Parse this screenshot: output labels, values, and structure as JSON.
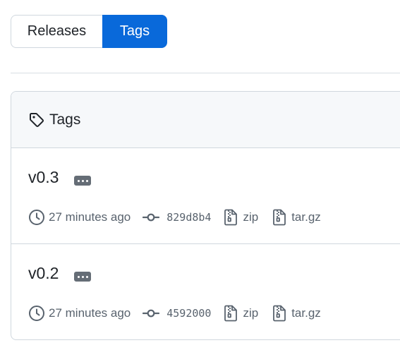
{
  "tabs": {
    "releases_label": "Releases",
    "tags_label": "Tags",
    "selected": "Tags"
  },
  "box": {
    "header_title": "Tags"
  },
  "tags": [
    {
      "name": "v0.3",
      "time": "27 minutes ago",
      "commit": "829d8b4",
      "zip_label": "zip",
      "targz_label": "tar.gz"
    },
    {
      "name": "v0.2",
      "time": "27 minutes ago",
      "commit": "4592000",
      "zip_label": "zip",
      "targz_label": "tar.gz"
    }
  ],
  "colors": {
    "accent": "#0969da",
    "border": "#d0d7de",
    "header_bg": "#f6f8fa",
    "muted_text": "#59636e"
  },
  "icons": {
    "header": "tag-icon",
    "time": "clock-icon",
    "commit": "git-commit-icon",
    "zip": "file-zip-icon",
    "targz": "file-zip-icon",
    "ellipsis": "kebab-horizontal-icon"
  }
}
